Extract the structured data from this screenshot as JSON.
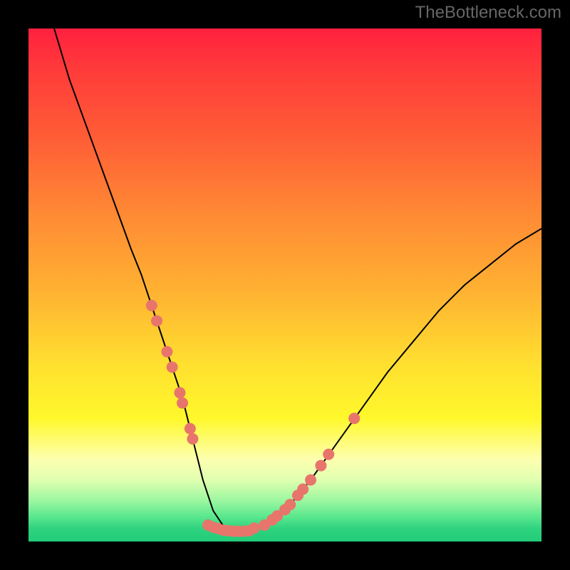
{
  "watermark": "TheBottleneck.com",
  "chart_data": {
    "type": "line",
    "title": "",
    "xlabel": "",
    "ylabel": "",
    "xlim": [
      0,
      100
    ],
    "ylim": [
      0,
      100
    ],
    "grid": false,
    "legend": false,
    "series": [
      {
        "name": "curve",
        "x": [
          5,
          8,
          12,
          16,
          20,
          22,
          24,
          26,
          28,
          30,
          31,
          32,
          33,
          34,
          36,
          38,
          40,
          43,
          44,
          45,
          46.5,
          50,
          55,
          60,
          65,
          70,
          75,
          80,
          85,
          90,
          95,
          100
        ],
        "y": [
          100,
          90,
          79,
          68,
          57,
          52,
          46,
          40,
          34,
          28,
          24,
          20,
          16,
          12,
          6,
          3,
          2,
          2,
          2.2,
          2.6,
          3.4,
          6,
          12,
          19,
          26,
          33,
          39,
          45,
          50,
          54,
          58,
          61
        ]
      }
    ],
    "markers": [
      {
        "x": 24,
        "y": 46
      },
      {
        "x": 25,
        "y": 43
      },
      {
        "x": 27,
        "y": 37
      },
      {
        "x": 28,
        "y": 34
      },
      {
        "x": 29.5,
        "y": 29
      },
      {
        "x": 30,
        "y": 27
      },
      {
        "x": 31.5,
        "y": 22
      },
      {
        "x": 32,
        "y": 20
      },
      {
        "x": 35,
        "y": 3.2
      },
      {
        "x": 36,
        "y": 2.8
      },
      {
        "x": 37,
        "y": 2.5
      },
      {
        "x": 38,
        "y": 2.2
      },
      {
        "x": 39,
        "y": 2.1
      },
      {
        "x": 40,
        "y": 2.0
      },
      {
        "x": 41,
        "y": 2.0
      },
      {
        "x": 42,
        "y": 2.0
      },
      {
        "x": 43,
        "y": 2.1
      },
      {
        "x": 44,
        "y": 2.6
      },
      {
        "x": 46,
        "y": 3.2
      },
      {
        "x": 47.5,
        "y": 4.2
      },
      {
        "x": 48.5,
        "y": 5.0
      },
      {
        "x": 50,
        "y": 6.2
      },
      {
        "x": 51,
        "y": 7.2
      },
      {
        "x": 52.5,
        "y": 9.0
      },
      {
        "x": 53.5,
        "y": 10.2
      },
      {
        "x": 55,
        "y": 12.0
      },
      {
        "x": 57,
        "y": 14.8
      },
      {
        "x": 58.5,
        "y": 17.0
      },
      {
        "x": 63.5,
        "y": 24.0
      }
    ],
    "gradient_colors": {
      "top": "#ff203e",
      "mid_upper": "#ff8934",
      "mid": "#ffe12f",
      "mid_lower": "#fdffb0",
      "bottom": "#21cc78"
    },
    "dot_color": "#e8756b",
    "curve_color": "#000000"
  }
}
